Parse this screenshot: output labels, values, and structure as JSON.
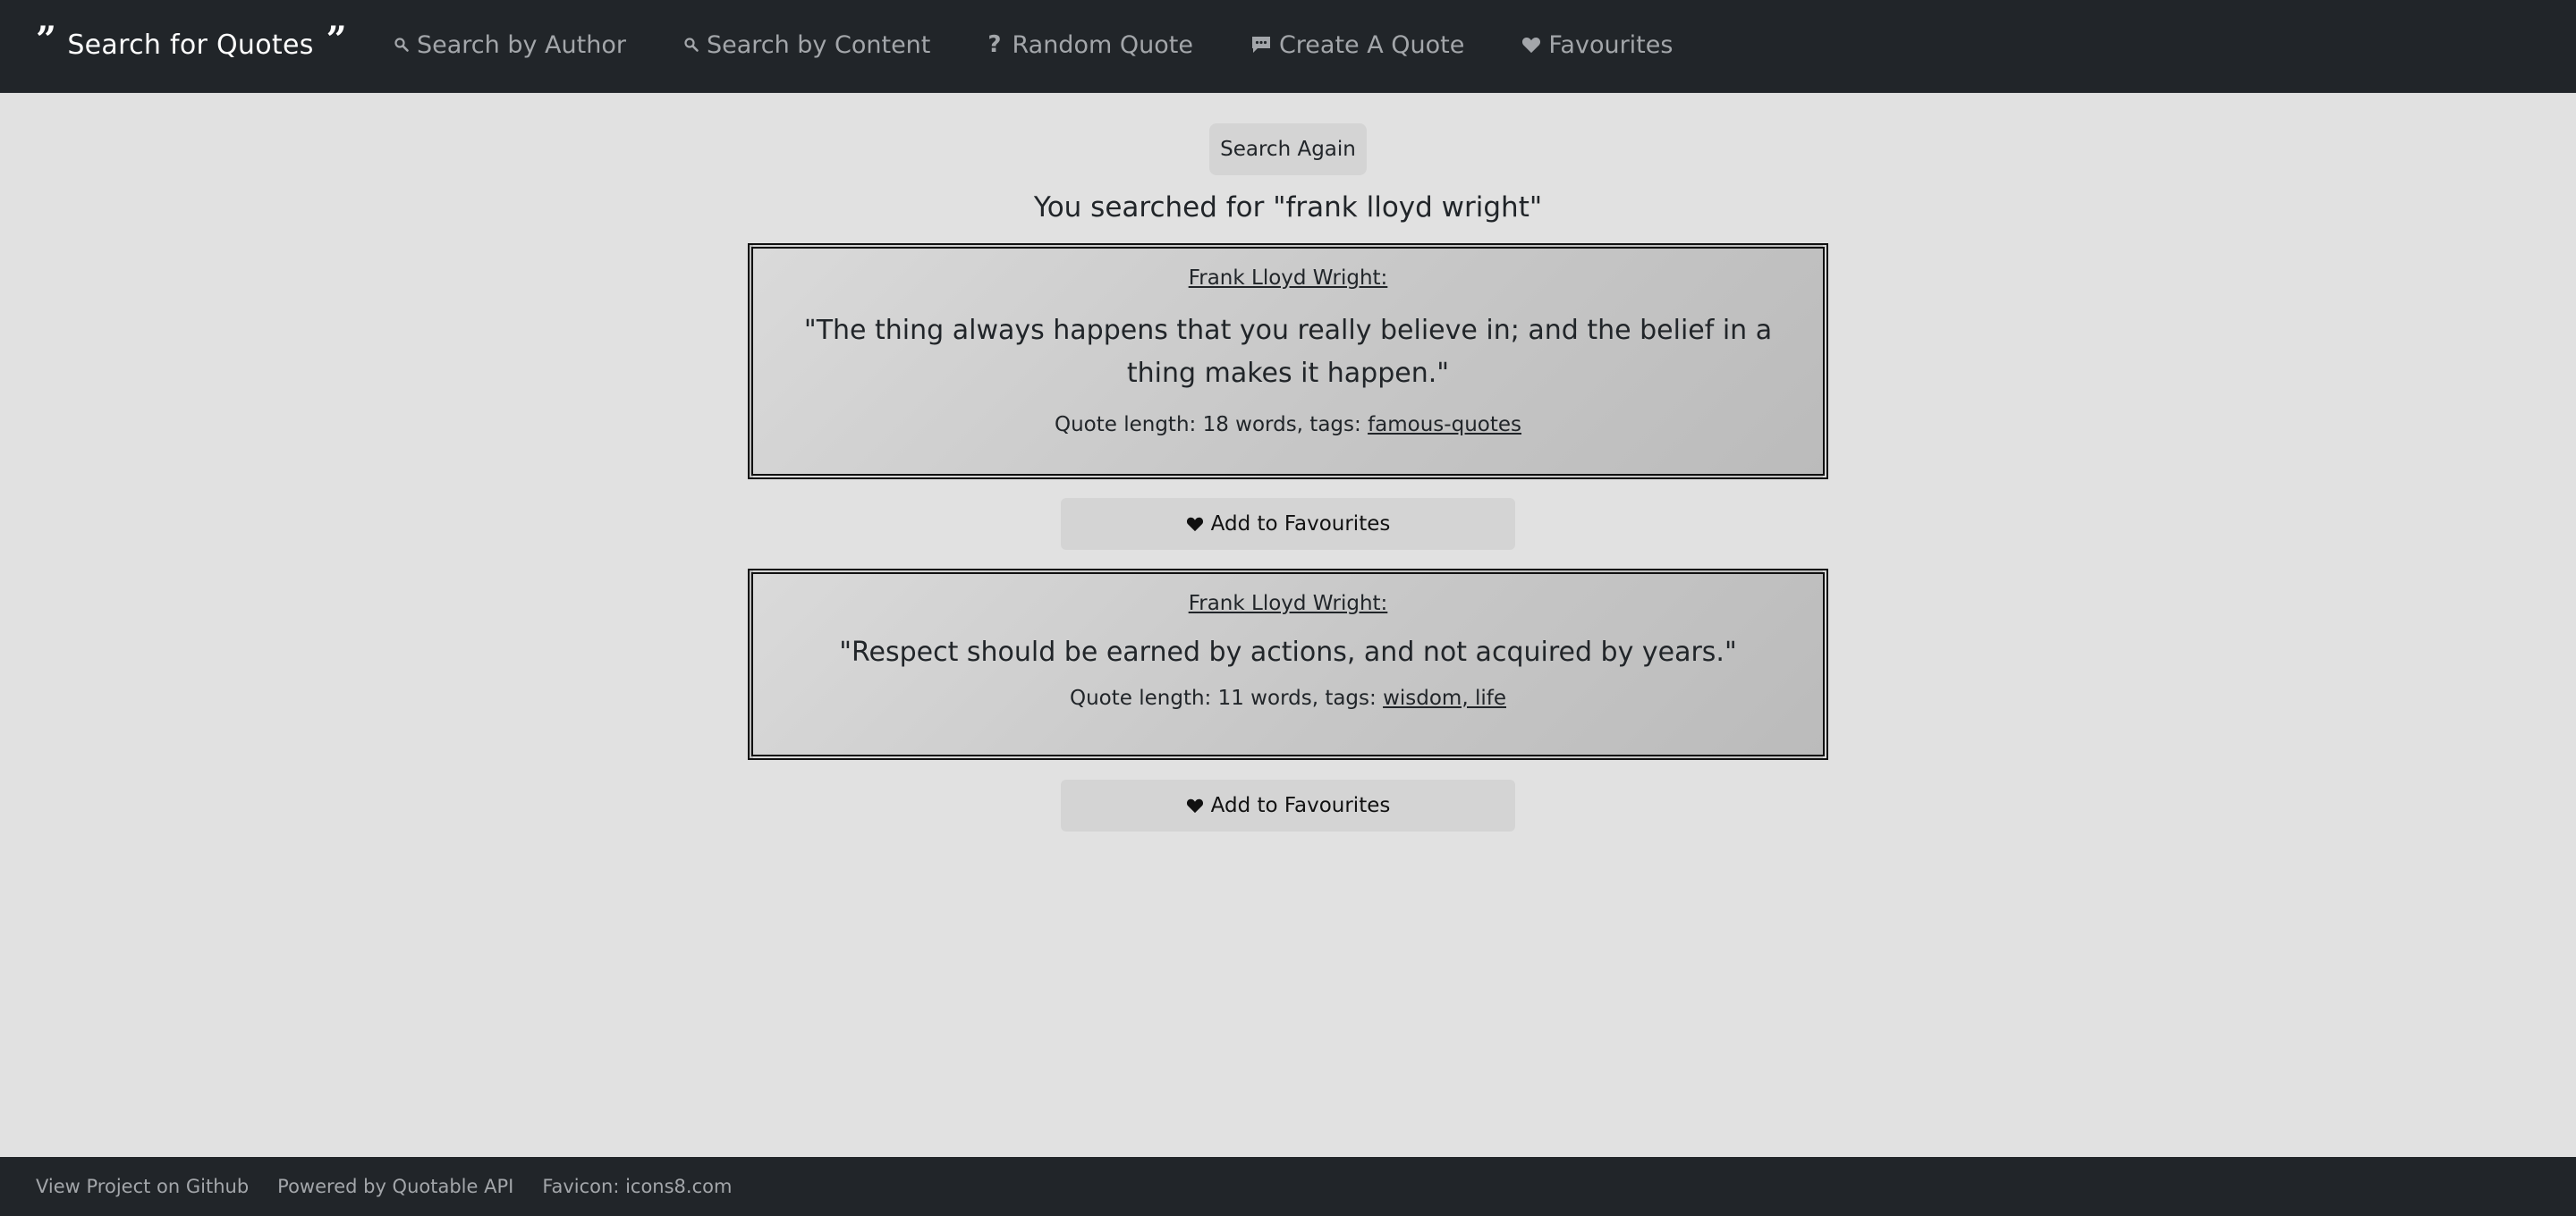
{
  "brand": {
    "title": "Search for Quotes",
    "open_quote": "”",
    "close_quote": "”"
  },
  "nav": [
    {
      "label": "Search by Author",
      "icon": "search-icon"
    },
    {
      "label": "Search by Content",
      "icon": "search-icon"
    },
    {
      "label": "Random Quote",
      "icon": "question-mark-icon",
      "glyph": "?"
    },
    {
      "label": "Create A Quote",
      "icon": "speech-bubble-icon"
    },
    {
      "label": "Favourites",
      "icon": "heart-icon"
    }
  ],
  "main": {
    "search_again_label": "Search Again",
    "searched_text": "You searched for \"frank lloyd wright\""
  },
  "quotes": [
    {
      "author": "Frank Lloyd Wright:",
      "text": "\"The thing always happens that you really believe in; and the belief in a thing makes it happen.\"",
      "meta_prefix": "Quote length: 18 words, tags: ",
      "tags": "famous-quotes",
      "fav_label": "Add to Favourites"
    },
    {
      "author": "Frank Lloyd Wright:",
      "text": "\"Respect should be earned by actions, and not acquired by years.\"",
      "meta_prefix": "Quote length: 11 words, tags: ",
      "tags": "wisdom, life",
      "fav_label": "Add to Favourites"
    }
  ],
  "footer": {
    "github": "View Project on Github",
    "powered": "Powered by Quotable API",
    "favicon": "Favicon: icons8.com"
  },
  "colors": {
    "navbar_bg": "#212529",
    "page_bg": "#e1e1e1",
    "nav_text": "#a3a6aa",
    "button_bg": "#d4d4d4"
  }
}
